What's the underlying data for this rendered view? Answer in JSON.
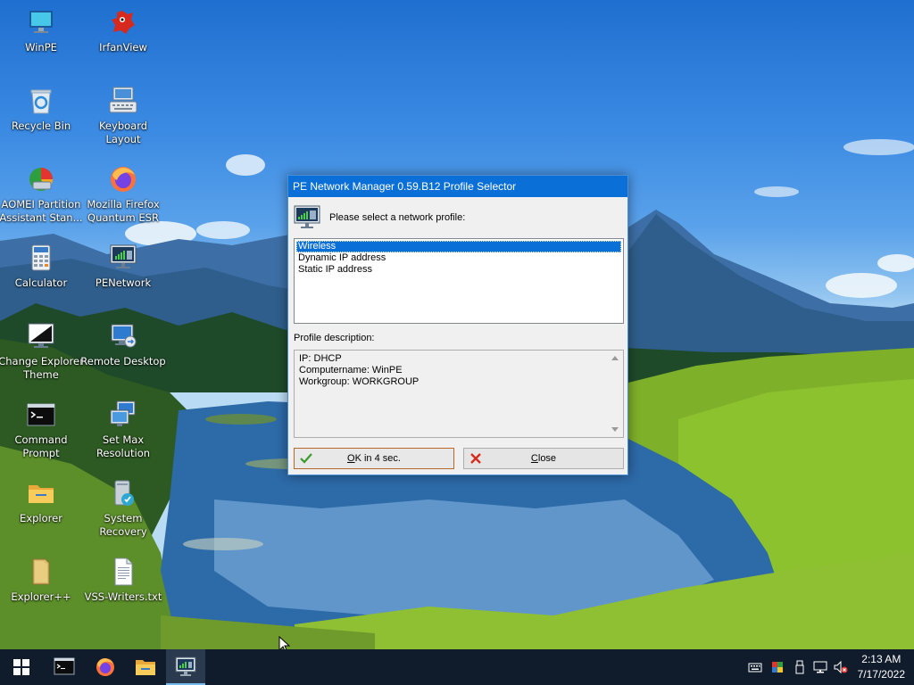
{
  "desktop": {
    "icons": [
      {
        "label": "WinPE",
        "icon": "monitor-icon"
      },
      {
        "label": "IrfanView",
        "icon": "irfanview-icon"
      },
      {
        "label": "Recycle Bin",
        "icon": "recycle-bin-icon"
      },
      {
        "label": "Keyboard Layout",
        "icon": "keyboard-icon"
      },
      {
        "label": "AOMEI Partition\nAssistant Stan...",
        "icon": "aomei-partition-icon"
      },
      {
        "label": "Mozilla Firefox\nQuantum ESR",
        "icon": "firefox-icon"
      },
      {
        "label": "Calculator",
        "icon": "calculator-icon"
      },
      {
        "label": "PENetwork",
        "icon": "penetwork-icon"
      },
      {
        "label": "Change Explorer\nTheme",
        "icon": "theme-icon"
      },
      {
        "label": "Remote Desktop",
        "icon": "remote-desktop-icon"
      },
      {
        "label": "Command\nPrompt",
        "icon": "command-prompt-icon"
      },
      {
        "label": "Set Max\nResolution",
        "icon": "resolution-icon"
      },
      {
        "label": "Explorer",
        "icon": "folder-icon"
      },
      {
        "label": "System Recovery",
        "icon": "system-recovery-icon"
      },
      {
        "label": "Explorer++",
        "icon": "explorer-plus-icon"
      },
      {
        "label": "VSS-Writers.txt",
        "icon": "text-file-icon"
      }
    ]
  },
  "dialog": {
    "title": "PE Network Manager 0.59.B12 Profile Selector",
    "prompt": "Please select a network profile:",
    "profiles": [
      "Wireless",
      "Dynamic IP address",
      "Static IP address"
    ],
    "selected_profile": "Wireless",
    "description_label": "Profile description:",
    "description_lines": [
      "IP: DHCP",
      "Computername: WinPE",
      "Workgroup: WORKGROUP"
    ],
    "ok_button": {
      "accel": "O",
      "rest": "K in 4 sec."
    },
    "close_button": {
      "accel": "C",
      "rest": "lose"
    }
  },
  "taskbar": {
    "pinned": [
      "start-icon",
      "command-prompt-icon",
      "firefox-icon",
      "folder-icon",
      "penetwork-icon"
    ],
    "active": "penetwork-icon",
    "tray": [
      "keyboard-icon",
      "color-icon",
      "usb-icon",
      "network-icon",
      "volume-muted-icon"
    ],
    "time": "2:13 AM",
    "date": "7/17/2022"
  },
  "colors": {
    "title_bar": "#0a6fd6",
    "selection": "#0a6fd6",
    "taskbar": "#101c2c",
    "ok_border": "#b7692b"
  }
}
